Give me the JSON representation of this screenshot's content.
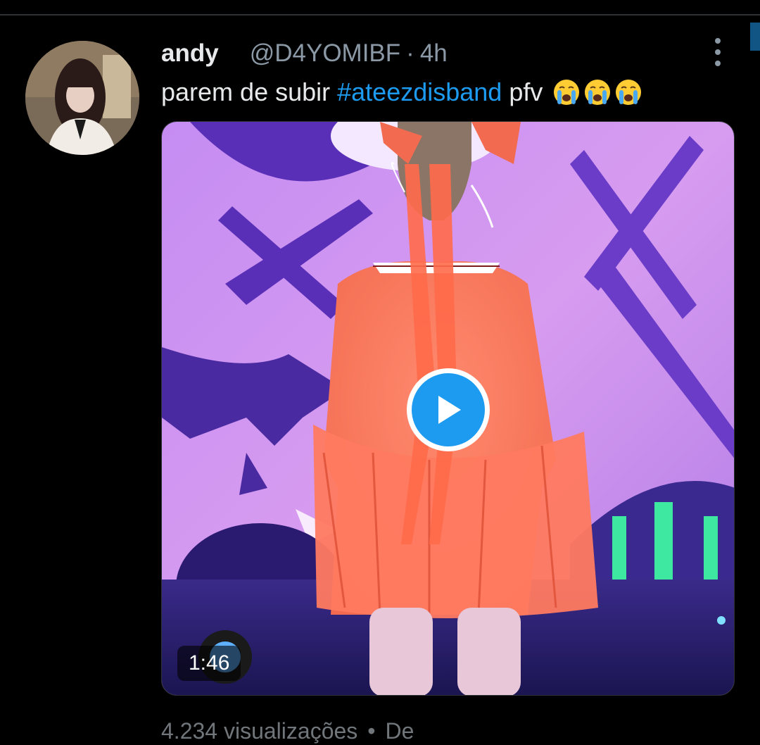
{
  "tweet": {
    "author": {
      "display_name": "andy",
      "handle": "@D4YOMIBF",
      "avatar_icon": "profile-photo"
    },
    "separator": "·",
    "time": "4h",
    "text": {
      "before": "parem de subir ",
      "hashtag": "#ateezdisband",
      "after": " pfv",
      "emojis": [
        "😭",
        "😭",
        "😭"
      ]
    },
    "media": {
      "type": "video",
      "duration": "1:46",
      "play_icon": "play-icon"
    },
    "footer": {
      "views": "4.234 visualizações",
      "separator": "•",
      "source": "De"
    },
    "more_icon": "more-vertical-icon"
  },
  "colors": {
    "background": "#000000",
    "text_primary": "#e7e9ea",
    "text_secondary": "#8b98a5",
    "accent": "#1d9bf0"
  }
}
